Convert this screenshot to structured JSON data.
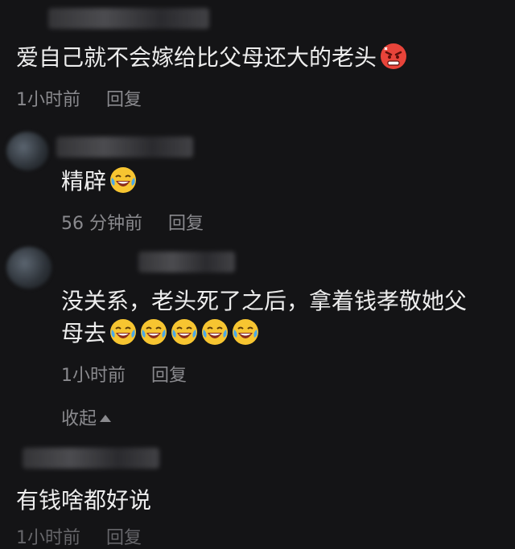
{
  "comments": [
    {
      "text": "爱自己就不会嫁给比父母还大的老头",
      "emoji": "angry-face-icon",
      "time": "1小时前",
      "reply": "回复"
    },
    {
      "text": "精辟",
      "emoji": "laughing-crying-face-icon",
      "time": "56 分钟前",
      "reply": "回复"
    },
    {
      "text_line1": "没关系，老头死了之后，拿着钱孝敬她父",
      "text_line2": "母去",
      "emoji": "laughing-crying-face-icon",
      "emoji_count": 5,
      "time": "1小时前",
      "reply": "回复",
      "collapse_label": "收起"
    },
    {
      "text": "有钱啥都好说",
      "time": "1小时前",
      "reply": "回复"
    }
  ],
  "colors": {
    "background": "#141416",
    "text": "#ededed",
    "meta": "#8a8a8e",
    "emoji_yellow": "#f7c531",
    "emoji_red": "#e8443a"
  }
}
